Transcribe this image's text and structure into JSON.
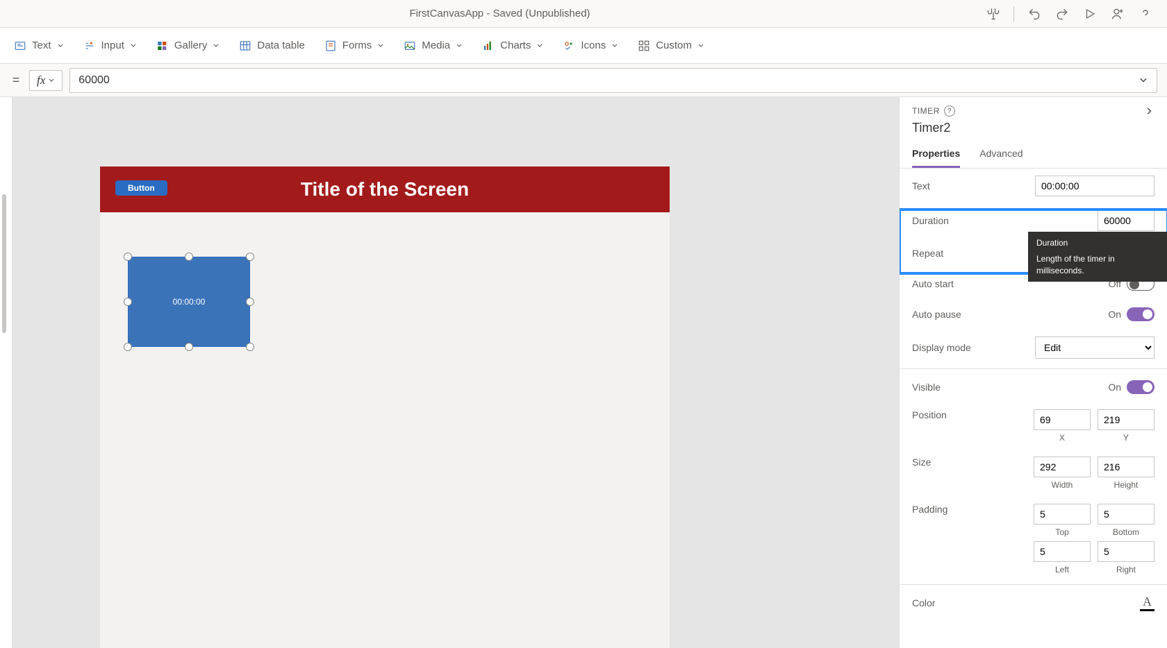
{
  "app": {
    "title": "FirstCanvasApp - Saved (Unpublished)"
  },
  "ribbon": {
    "items": [
      {
        "label": "Text"
      },
      {
        "label": "Input"
      },
      {
        "label": "Gallery"
      },
      {
        "label": "Data table"
      },
      {
        "label": "Forms"
      },
      {
        "label": "Media"
      },
      {
        "label": "Charts"
      },
      {
        "label": "Icons"
      },
      {
        "label": "Custom"
      }
    ]
  },
  "formula": {
    "value": "60000"
  },
  "canvas": {
    "button_label": "Button",
    "screen_title": "Title of the Screen",
    "timer_text": "00:00:00"
  },
  "properties": {
    "type": "TIMER",
    "name": "Timer2",
    "tabs": {
      "properties": "Properties",
      "advanced": "Advanced"
    },
    "rows": {
      "text": {
        "label": "Text",
        "value": "00:00:00"
      },
      "duration": {
        "label": "Duration",
        "value": "60000"
      },
      "repeat": {
        "label": "Repeat"
      },
      "autostart": {
        "label": "Auto start",
        "value": "Off"
      },
      "autopause": {
        "label": "Auto pause",
        "value": "On"
      },
      "displaymode": {
        "label": "Display mode",
        "value": "Edit"
      },
      "visible": {
        "label": "Visible",
        "value": "On"
      },
      "position": {
        "label": "Position",
        "x": "69",
        "y": "219",
        "xlabel": "X",
        "ylabel": "Y"
      },
      "size": {
        "label": "Size",
        "w": "292",
        "h": "216",
        "wlabel": "Width",
        "hlabel": "Height"
      },
      "padding": {
        "label": "Padding",
        "top": "5",
        "bottom": "5",
        "left": "5",
        "right": "5",
        "toplabel": "Top",
        "bottomlabel": "Bottom",
        "leftlabel": "Left",
        "rightlabel": "Right"
      },
      "color": {
        "label": "Color"
      }
    }
  },
  "tooltip": {
    "title": "Duration",
    "body": "Length of the timer in milliseconds."
  }
}
